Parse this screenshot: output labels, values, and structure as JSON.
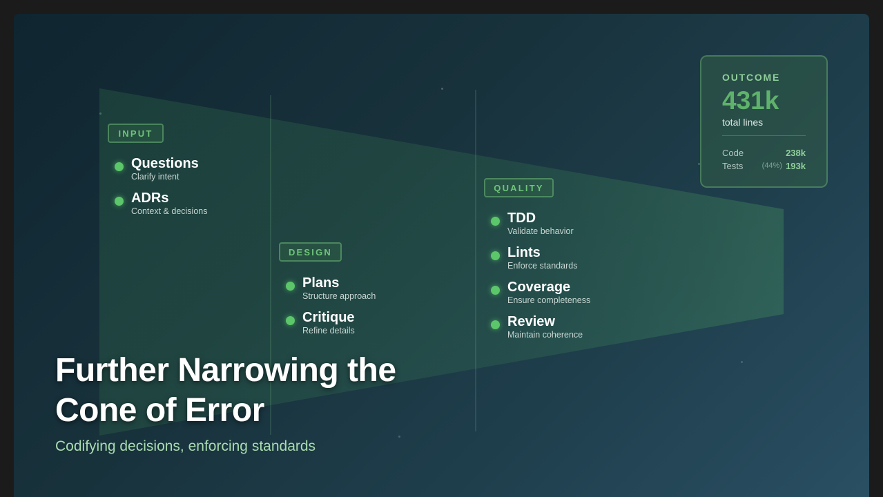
{
  "title_line1": "Further Narrowing the",
  "title_line2": "Cone of Error",
  "subtitle": "Codifying decisions, enforcing standards",
  "stages": {
    "input": {
      "label": "INPUT",
      "items": [
        {
          "title": "Questions",
          "subtitle": "Clarify intent"
        },
        {
          "title": "ADRs",
          "subtitle": "Context & decisions"
        }
      ]
    },
    "design": {
      "label": "DESIGN",
      "items": [
        {
          "title": "Plans",
          "subtitle": "Structure approach"
        },
        {
          "title": "Critique",
          "subtitle": "Refine details"
        }
      ]
    },
    "quality": {
      "label": "QUALITY",
      "items": [
        {
          "title": "TDD",
          "subtitle": "Validate behavior"
        },
        {
          "title": "Lints",
          "subtitle": "Enforce standards"
        },
        {
          "title": "Coverage",
          "subtitle": "Ensure completeness"
        },
        {
          "title": "Review",
          "subtitle": "Maintain coherence"
        }
      ]
    }
  },
  "outcome": {
    "label": "OUTCOME",
    "value": "431k",
    "unit": "total lines",
    "rows": [
      {
        "key": "Code",
        "value": "238k",
        "pct": ""
      },
      {
        "key": "Tests",
        "value": "193k",
        "pct": "(44%)"
      }
    ]
  },
  "colors": {
    "accent": "#5cc66a",
    "tag_text": "#6fc47a",
    "outcome_value": "#5fb26b",
    "subtitle": "#a9dcaf",
    "cone_fill": "#3e8a55"
  }
}
